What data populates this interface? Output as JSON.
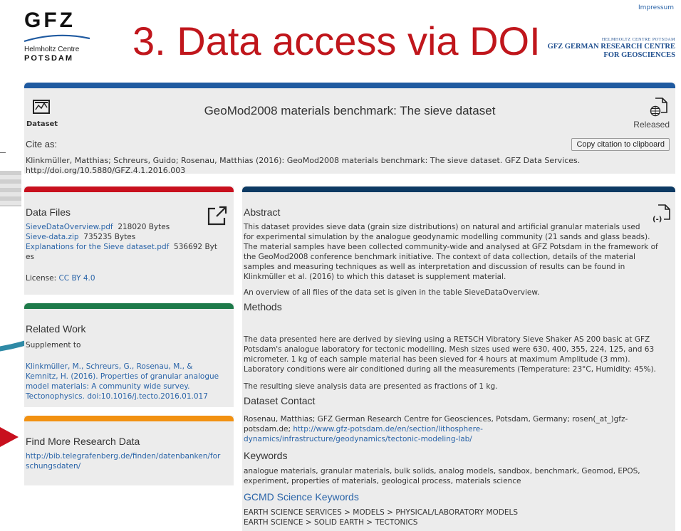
{
  "header": {
    "logo_main": "GFZ",
    "logo_line1": "Helmholtz Centre",
    "logo_line2": "POTSDAM",
    "slide_title": "3. Data access via DOI",
    "impressum": "Impressum",
    "right_logo_small": "HELMHOLTZ CENTRE POTSDAM",
    "right_logo_line1": "GFZ GERMAN RESEARCH CENTRE",
    "right_logo_line2": "FOR GEOSCIENCES"
  },
  "colors": {
    "blue": "#1f5aa0",
    "darkblue": "#0d3a63",
    "red": "#c8101e",
    "green": "#1e7a4a",
    "orange": "#f29111",
    "teal": "#2f8aa6"
  },
  "dataset": {
    "type_label": "Dataset",
    "title": "GeoMod2008 materials benchmark: The sieve dataset",
    "status": "Released",
    "cite_as": "Cite as:",
    "copy_button": "Copy citation to clipboard",
    "citation_line1": "Klinkmüller, Matthias; Schreurs, Guido; Rosenau, Matthias (2016): GeoMod2008 materials benchmark: The sieve dataset. GFZ Data Services.",
    "citation_line2": "http://doi.org/10.5880/GFZ.4.1.2016.003"
  },
  "data_files": {
    "heading": "Data Files",
    "files": [
      {
        "name": "SieveDataOverview.pdf",
        "size": "218020 Bytes"
      },
      {
        "name": "Sieve-data.zip",
        "size": "735235 Bytes"
      },
      {
        "name": "Explanations for the Sieve dataset.pdf",
        "size": "536692 Byt"
      }
    ],
    "size_wrap": "es",
    "license_label": "License:",
    "license_value": "CC BY 4.0"
  },
  "related_work": {
    "heading": "Related Work",
    "relation": "Supplement to",
    "reference": [
      "Klinkmüller, M., Schreurs, G., Rosenau, M., &",
      "Kemnitz, H. (2016). Properties of granular analogue",
      "model materials: A community wide survey.",
      "Tectonophysics. doi:10.1016/j.tecto.2016.01.017"
    ]
  },
  "find_more": {
    "heading": "Find More Research Data",
    "url_lines": [
      "http://bib.telegrafenberg.de/finden/datenbanken/for",
      "schungsdaten/"
    ]
  },
  "abstract": {
    "heading": "Abstract",
    "lines": [
      "This dataset provides sieve data (grain size distributions) on natural and artificial granular materials used",
      "for experimental simulation by the analogue geodynamic modelling community (21 sands and glass beads).",
      "The material samples have been collected community-wide and analysed at GFZ Potsdam in the framework of",
      "the GeoMod2008 conference benchmark initiative. The context of data collection, details of the material",
      "samples and measuring techniques as well as interpretation and discussion of results can be found in",
      "Klinkmüller et al. (2016) to which this dataset is supplement material."
    ],
    "overview": "An overview of all files of the data set is given in the table SieveDataOverview."
  },
  "methods": {
    "heading": "Methods",
    "lines": [
      "The data presented here are derived by sieving using a RETSCH Vibratory Sieve Shaker AS 200 basic at GFZ",
      "Potsdam's analogue laboratory for tectonic modelling. Mesh sizes used were 630, 400, 355, 224, 125, and 63",
      "micrometer. 1 kg of each sample material has been sieved for 4 hours at maximum Amplitude (3 mm).",
      "Laboratory conditions were air conditioned during all the measurements (Temperature: 23°C, Humidity: 45%)."
    ],
    "result": "The resulting sieve analysis data are presented as fractions of 1 kg."
  },
  "contact": {
    "heading": "Dataset Contact",
    "line1": "Rosenau, Matthias; GFZ German Research Centre for Geosciences, Potsdam, Germany; rosen(_at_)gfz-",
    "line2_text": "potsdam.de;",
    "line2_link": "http://www.gfz-potsdam.de/en/section/lithosphere-",
    "line3_link": "dynamics/infrastructure/geodynamics/tectonic-modeling-lab/"
  },
  "keywords": {
    "heading": "Keywords",
    "lines": [
      "analogue materials, granular materials, bulk solids, analog models, sandbox, benchmark, Geomod, EPOS,",
      "experiment, properties of materials, geological process, materials science"
    ]
  },
  "gcmd": {
    "heading": "GCMD Science Keywords",
    "lines": [
      "EARTH SCIENCE SERVICES > MODELS > PHYSICAL/LABORATORY MODELS",
      "EARTH SCIENCE > SOLID EARTH > TECTONICS"
    ]
  }
}
